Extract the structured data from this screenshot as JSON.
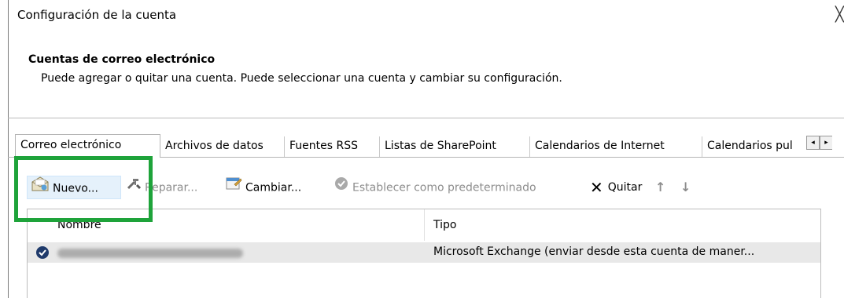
{
  "window": {
    "title": "Configuración de la cuenta",
    "close_glyph": "╳"
  },
  "header": {
    "section_title": "Cuentas de correo electrónico",
    "description": "Puede agregar o quitar una cuenta. Puede seleccionar una cuenta y cambiar su configuración."
  },
  "tabs": [
    {
      "label": "Correo electrónico",
      "active": true
    },
    {
      "label": "Archivos de datos"
    },
    {
      "label": "Fuentes RSS"
    },
    {
      "label": "Listas de SharePoint"
    },
    {
      "label": "Calendarios de Internet"
    },
    {
      "label": "Calendarios pul"
    }
  ],
  "tab_scroll": {
    "left": "◂",
    "right": "▸"
  },
  "toolbar": {
    "new_label": "Nuevo...",
    "repair_label": "Reparar...",
    "change_label": "Cambiar...",
    "set_default_label": "Establecer como predeterminado",
    "remove_label": "Quitar",
    "remove_glyph": "✕",
    "up_glyph": "↑",
    "down_glyph": "↓"
  },
  "accounts_list": {
    "columns": [
      "Nombre",
      "Tipo"
    ],
    "rows": [
      {
        "name": "",
        "type": "Microsoft Exchange (enviar desde esta cuenta de maner..."
      }
    ]
  },
  "colors": {
    "highlight": "#1ea33a",
    "row_selected": "#e8e8e8",
    "disabled_text": "#8d8d8d"
  }
}
